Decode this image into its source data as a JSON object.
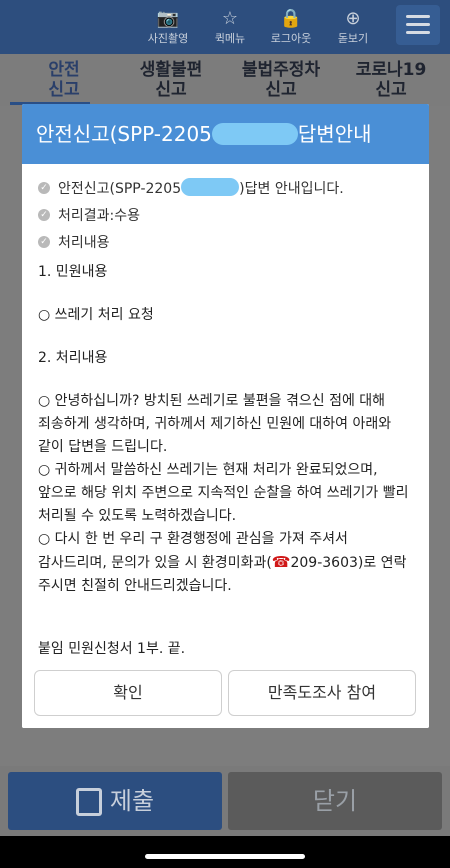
{
  "topbar": {
    "items": [
      {
        "label": "사진촬영",
        "icon": "camera-icon"
      },
      {
        "label": "퀵메뉴",
        "icon": "star-icon"
      },
      {
        "label": "로그아웃",
        "icon": "lock-icon"
      },
      {
        "label": "돋보기",
        "icon": "zoom-in-icon"
      }
    ],
    "menu_icon": "hamburger-icon"
  },
  "tabs": [
    {
      "label": "안전\n신고",
      "active": true
    },
    {
      "label": "생활불편\n신고",
      "active": false
    },
    {
      "label": "불법주정차\n신고",
      "active": false
    },
    {
      "label": "코로나19\n신고",
      "active": false
    }
  ],
  "modal": {
    "title_prefix": "안전신고(SPP-2205",
    "title_suffix": "답변안내",
    "checks": [
      {
        "prefix": "안전신고(SPP-2205",
        "suffix": ")답변 안내입니다."
      },
      {
        "text": "처리결과:수용"
      },
      {
        "text": "처리내용"
      }
    ],
    "section1": "1. 민원내용",
    "request": "○ 쓰레기 처리 요청",
    "section2": "2. 처리내용",
    "p1": "○ 안녕하십니까? 방치된 쓰레기로 불편을 겪으신 점에 대해 죄송하게 생각하며, 귀하께서 제기하신 민원에 대하여 아래와 같이 답변을 드립니다.",
    "p2": "○ 귀하께서 말씀하신 쓰레기는 현재 처리가 완료되었으며, 앞으로 해당 위치 주변으로 지속적인 순찰을 하여 쓰레기가 빨리 처리될 수 있도록 노력하겠습니다.",
    "p3_a": "○ 다시 한 번 우리 구 환경행정에 관심을 가져 주셔서 감사드리며, 문의가 있을 시 환경미화과(",
    "p3_phone": "209-3603",
    "p3_b": ")로 연락 주시면 친절히 안내드리겠습니다.",
    "attachment": "붙임 민원신청서 1부. 끝.",
    "confirm_label": "확인",
    "survey_label": "만족도조사 참여"
  },
  "bottom": {
    "submit_label": "제출",
    "close_label": "닫기"
  },
  "colors": {
    "header_blue": "#4a8fd6",
    "mask_blue": "#7ec9f5",
    "topbar_navy": "#2d4e7e"
  }
}
